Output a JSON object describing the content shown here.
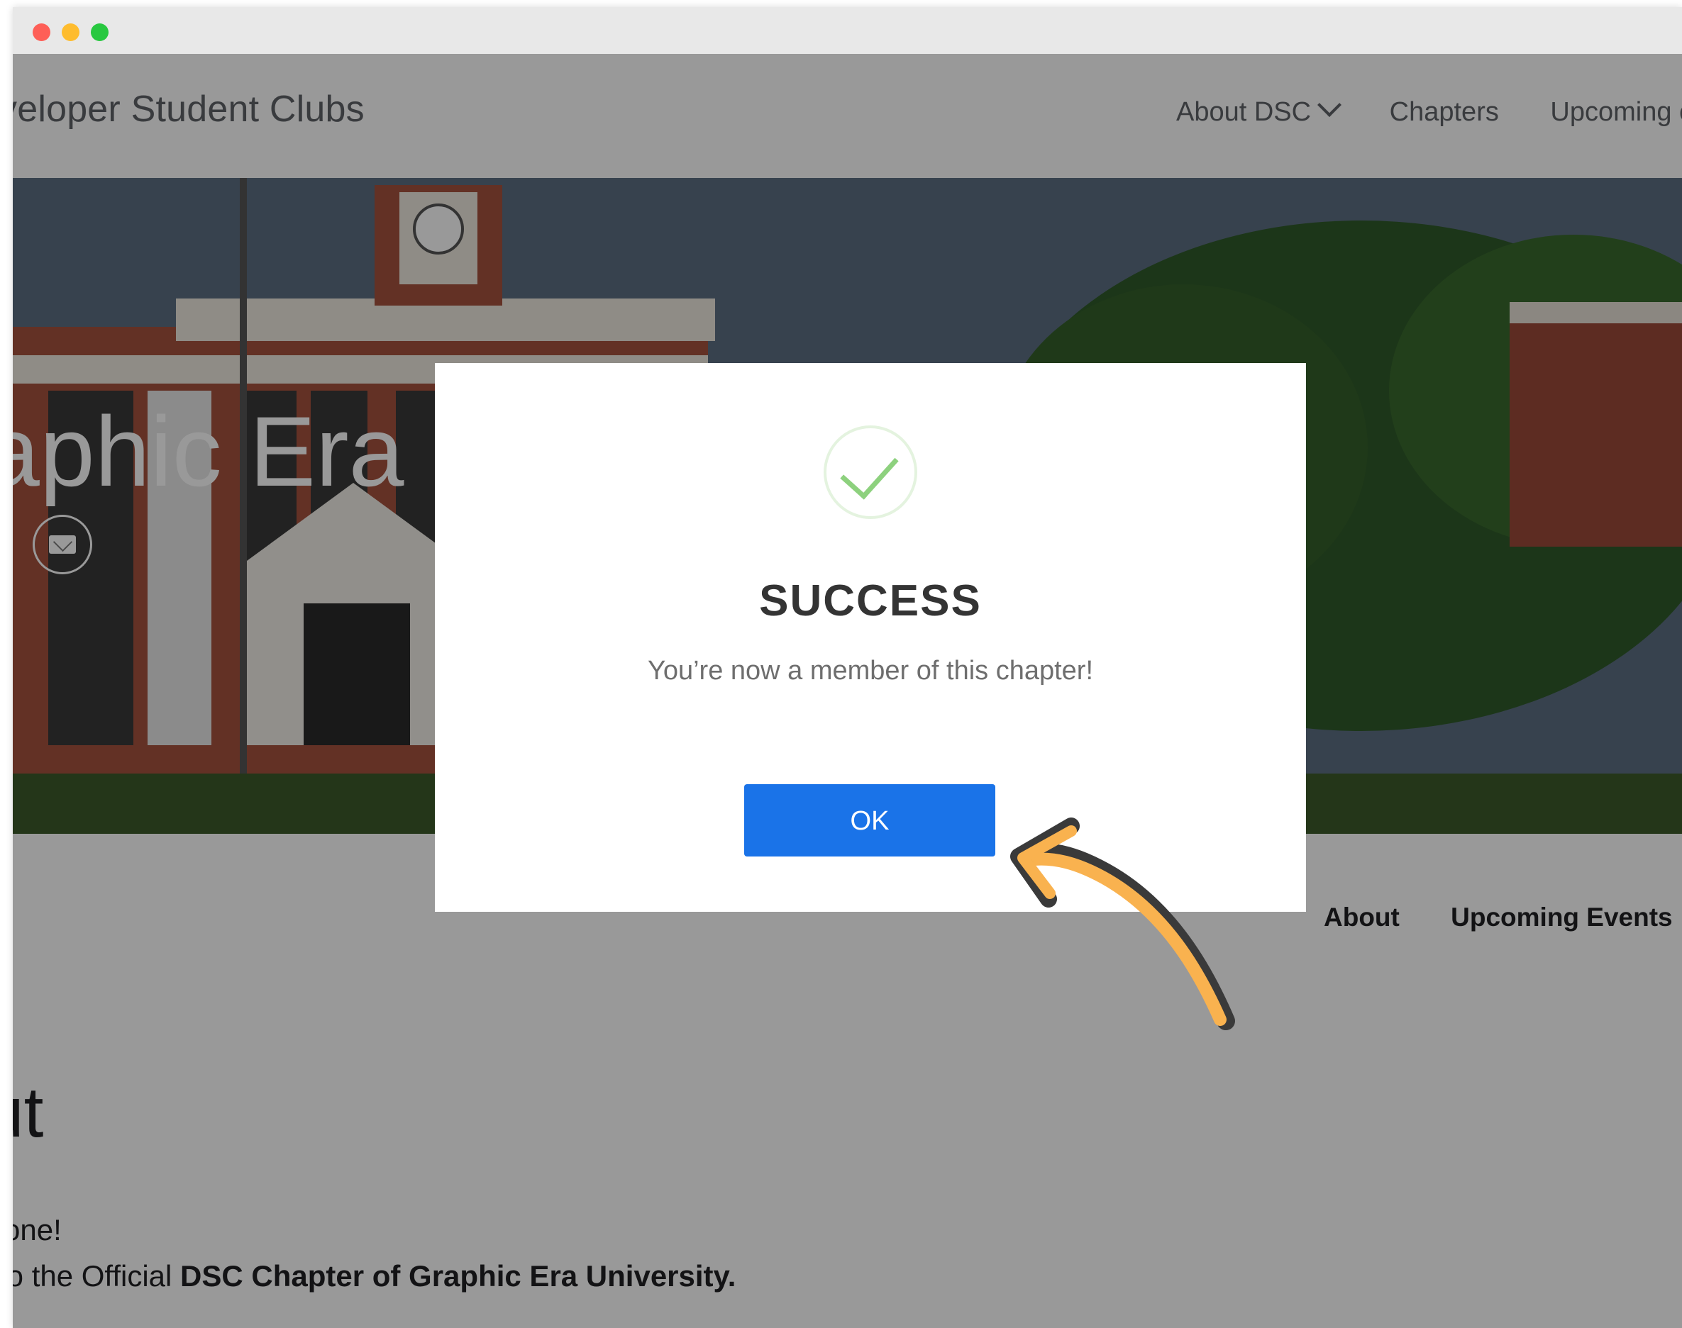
{
  "site": {
    "brand": "veloper Student Clubs",
    "nav": {
      "about_dsc": "About DSC",
      "chapters": "Chapters",
      "upcoming": "Upcoming ev"
    }
  },
  "hero": {
    "title": "aphic Era"
  },
  "subnav": {
    "about": "About",
    "upcoming_events": "Upcoming Events"
  },
  "about_section": {
    "heading": "ut",
    "line1": "yone!",
    "line2_prefix": "to the Official ",
    "line2_bold": "DSC Chapter of Graphic Era University."
  },
  "modal": {
    "title": "SUCCESS",
    "message": "You’re now a member of this chapter!",
    "ok_label": "OK"
  },
  "colors": {
    "primary_button": "#1a73e8",
    "success_check": "#8dd17e",
    "annotation_arrow": "#f9b24f"
  },
  "icons": {
    "success": "check-circle-icon",
    "mail": "mail-icon",
    "dropdown": "chevron-down-icon",
    "annotation": "curved-arrow-icon"
  }
}
